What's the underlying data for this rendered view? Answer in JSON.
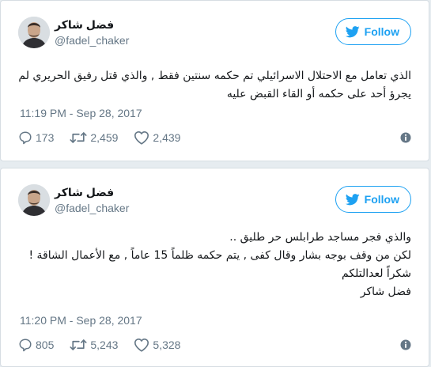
{
  "tweets": [
    {
      "display_name": "فضل شاكر",
      "handle": "@fadel_chaker",
      "follow_label": "Follow",
      "text_lines": [
        "الذي تعامل مع الاحتلال الاسرائيلي تم حكمه سنتين فقط , والذي قتل رفيق الحريري لم",
        "يجرؤ أحد على حكمه أو القاء القبض عليه"
      ],
      "timestamp": "11:19 PM - Sep 28, 2017",
      "replies": "173",
      "retweets": "2,459",
      "likes": "2,439"
    },
    {
      "display_name": "فضل شاكر",
      "handle": "@fadel_chaker",
      "follow_label": "Follow",
      "text_lines": [
        "والذي فجر مساجد طرابلس حر طليق ..",
        "لكن من وقف بوجه بشار وقال كفى , يتم حكمه ظلماً 15 عاماً , مع الأعمال الشاقة !",
        "شكراً لعدالتلكم",
        "فضل شاكر"
      ],
      "timestamp": "11:20 PM - Sep 28, 2017",
      "replies": "805",
      "retweets": "5,243",
      "likes": "5,328"
    }
  ],
  "icons": {
    "follow": "twitter-bird-icon",
    "reply": "reply-icon",
    "retweet": "retweet-icon",
    "like": "heart-icon",
    "info": "info-icon"
  },
  "colors": {
    "brand_blue": "#1da1f2",
    "muted": "#657786",
    "text": "#14171a",
    "background": "#e6ecf0"
  }
}
